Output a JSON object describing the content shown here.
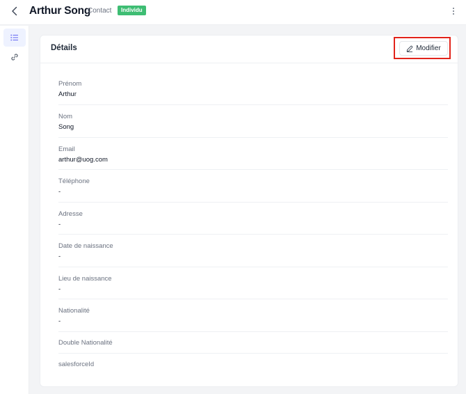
{
  "header": {
    "title": "Arthur Song",
    "type_label": "Contact",
    "badge": "Individu",
    "badge_color": "#3ebd73"
  },
  "sidebar": {
    "items": [
      {
        "icon": "list-icon",
        "active": true
      },
      {
        "icon": "link-icon",
        "active": false
      }
    ]
  },
  "card": {
    "title": "Détails",
    "edit_label": "Modifier",
    "edit_icon": "pencil-icon",
    "fields": [
      {
        "label": "Prénom",
        "value": "Arthur"
      },
      {
        "label": "Nom",
        "value": "Song"
      },
      {
        "label": "Email",
        "value": "arthur@uog.com"
      },
      {
        "label": "Téléphone",
        "value": "-"
      },
      {
        "label": "Adresse",
        "value": "-"
      },
      {
        "label": "Date de naissance",
        "value": "-"
      },
      {
        "label": "Lieu de naissance",
        "value": "-"
      },
      {
        "label": "Nationalité",
        "value": "-"
      },
      {
        "label": "Double Nationalité",
        "value": ""
      },
      {
        "label": "salesforceId",
        "value": ""
      }
    ]
  },
  "colors": {
    "highlight": "#e2231a",
    "accent": "#6366f1"
  }
}
